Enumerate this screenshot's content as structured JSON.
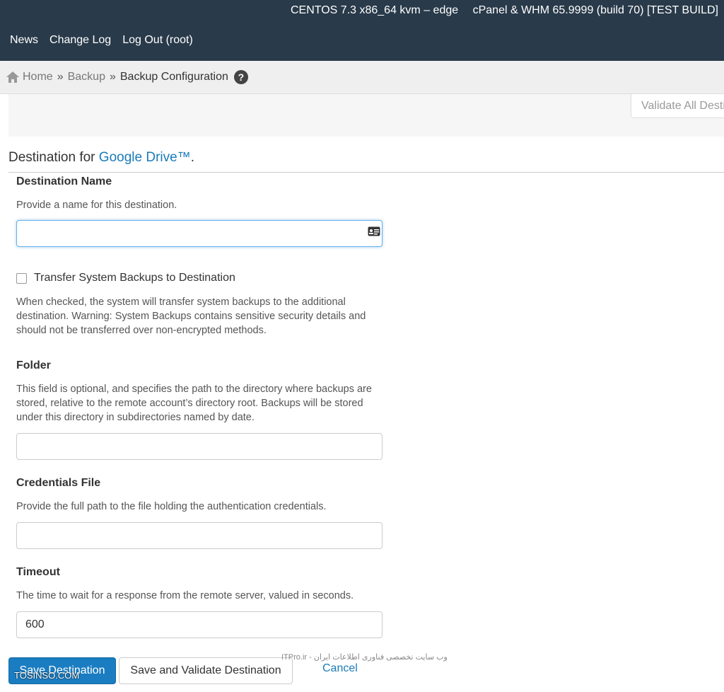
{
  "header": {
    "server": "CENTOS 7.3 x86_64 kvm – edge",
    "product": "cPanel & WHM 65.9999 (build 70) [TEST BUILD]",
    "nav": [
      "News",
      "Change Log",
      "Log Out (root)"
    ]
  },
  "breadcrumb": {
    "home": "Home",
    "backup": "Backup",
    "current": "Backup Configuration",
    "separator": "»",
    "help_glyph": "?"
  },
  "validate": {
    "label": "Validate All Destinations"
  },
  "destination": {
    "prefix": "Destination for ",
    "type": "Google Drive™",
    "suffix": "."
  },
  "fields": {
    "name": {
      "label": "Destination Name",
      "desc": "Provide a name for this destination.",
      "value": ""
    },
    "transfer": {
      "label": "Transfer System Backups to Destination",
      "desc": "When checked, the system will transfer system backups to the additional destination. Warning: System Backups contains sensitive security details and should not be transferred over non-encrypted methods.",
      "checked": false
    },
    "folder": {
      "label": "Folder",
      "desc": "This field is optional, and specifies the path to the directory where backups are stored, relative to the remote account’s directory root. Backups will be stored under this directory in subdirectories named by date.",
      "value": ""
    },
    "credentials": {
      "label": "Credentials File",
      "desc": "Provide the full path to the file holding the authentication credentials.",
      "value": ""
    },
    "timeout": {
      "label": "Timeout",
      "desc": "The time to wait for a response from the remote server, valued in seconds.",
      "value": "600"
    }
  },
  "actions": {
    "save": "Save Destination",
    "save_validate": "Save and Validate Destination",
    "cancel": "Cancel"
  },
  "watermarks": {
    "left": "TOSINSO.COM",
    "mid": "ITPro.ir - وب سایت تخصصی فناوری اطلاعات ایران"
  },
  "colors": {
    "topbar": "#293a4a",
    "link": "#1a7bb9",
    "primary": "#1b7dc1"
  }
}
